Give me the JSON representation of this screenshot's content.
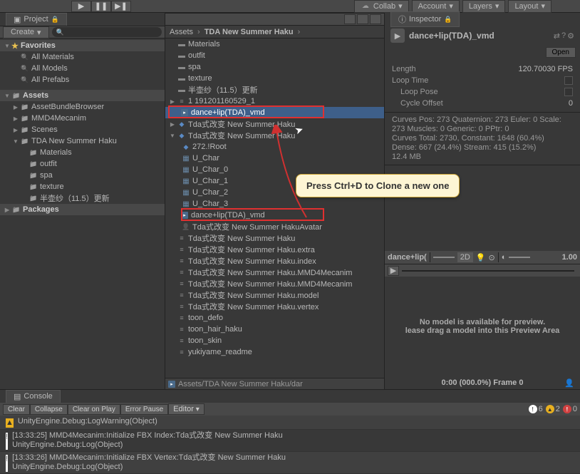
{
  "topbar": {
    "collab_label": "Collab",
    "account_label": "Account",
    "layers_label": "Layers",
    "layout_label": "Layout"
  },
  "project": {
    "tab_label": "Project",
    "create_label": "Create",
    "favorites_label": "Favorites",
    "fav_items": [
      "All Materials",
      "All Models",
      "All Prefabs"
    ],
    "assets_label": "Assets",
    "asset_folders": [
      "AssetBundleBrowser",
      "MMD4Mecanim",
      "Scenes"
    ],
    "tda_folder": "TDA New Summer Haku",
    "tda_subs": [
      "Materials",
      "outfit",
      "spa",
      "texture",
      "半壶纱（11.5）更新"
    ],
    "packages_label": "Packages"
  },
  "breadcrumb": {
    "root": "Assets",
    "folder": "TDA New Summer Haku"
  },
  "files": {
    "folders": [
      "Materials",
      "outfit",
      "spa",
      "texture",
      "半壶纱（11.5）更新"
    ],
    "f_index": "1  191201160529_1",
    "f_clip1": "dance+lip(TDA)_vmd",
    "f_tda_line": "Tda式改变 New Summer Haku",
    "f_tda_expand": "Tda式改变 New Summer Haku",
    "f_root": "272.!Root",
    "f_uchar": "U_Char",
    "f_uchars": [
      "U_Char_0",
      "U_Char_1",
      "U_Char_2",
      "U_Char_3"
    ],
    "f_clip2": "dance+lip(TDA)_vmd",
    "f_avatar": "Tda式改变 New Summer HakuAvatar",
    "f_haku2": "Tda式改变 New Summer Haku",
    "f_extra": "Tda式改变 New Summer Haku.extra",
    "f_idx": "Tda式改变 New Summer Haku.index",
    "f_mmd": "Tda式改变 New Summer Haku.MMD4Mecanim",
    "f_mmd2": "Tda式改变 New Summer Haku.MMD4Mecanim",
    "f_model": "Tda式改变 New Summer Haku.model",
    "f_vertex": "Tda式改变 New Summer Haku.vertex",
    "f_toon_defo": "toon_defo",
    "f_toon_hair": "toon_hair_haku",
    "f_toon_skin": "toon_skin",
    "f_readme": "yukiyame_readme"
  },
  "pathbar": "Assets/TDA New Summer Haku/dar",
  "inspector": {
    "tab_label": "Inspector",
    "title": "dance+lip(TDA)_vmd",
    "open_label": "Open",
    "props": {
      "length_label": "Length",
      "length_val": "120.700",
      "fps": "30 FPS",
      "looptime_label": "Loop Time",
      "looppose_label": "Loop Pose",
      "cycleoffset_label": "Cycle Offset",
      "cycleoffset_val": "0"
    },
    "stats": [
      "Curves Pos: 273 Quaternion: 273 Euler: 0 Scale:",
      "273 Muscles: 0 Generic: 0 PPtr: 0",
      "Curves Total: 2730, Constant: 1648 (60.4%)",
      "Dense: 667 (24.4%) Stream: 415 (15.2%)",
      "12.4 MB"
    ],
    "preview_name": "dance+lip(",
    "preview_2d": "2D",
    "preview_speed": "1.00",
    "preview_msg1": "No model is available for preview.",
    "preview_msg2": "lease drag a model into this Preview Area",
    "preview_footer": "0:00 (000.0%) Frame 0"
  },
  "console": {
    "tab_label": "Console",
    "btns": {
      "clear": "Clear",
      "collapse": "Collapse",
      "cop": "Clear on Play",
      "ep": "Error Pause",
      "editor": "Editor"
    },
    "counts": {
      "info": "6",
      "warn": "2",
      "err": "0"
    },
    "log1a": "",
    "log1b": "UnityEngine.Debug:LogWarning(Object)",
    "log2a": "[13:33:25] MMD4Mecanim:Initialize FBX Index:Tda式改变 New Summer Haku",
    "log2b": "UnityEngine.Debug:Log(Object)",
    "log3a": "[13:33:26] MMD4Mecanim:Initialize FBX Vertex:Tda式改变 New Summer Haku",
    "log3b": "UnityEngine.Debug:Log(Object)"
  },
  "annotation": "Press Ctrl+D to Clone a new one"
}
